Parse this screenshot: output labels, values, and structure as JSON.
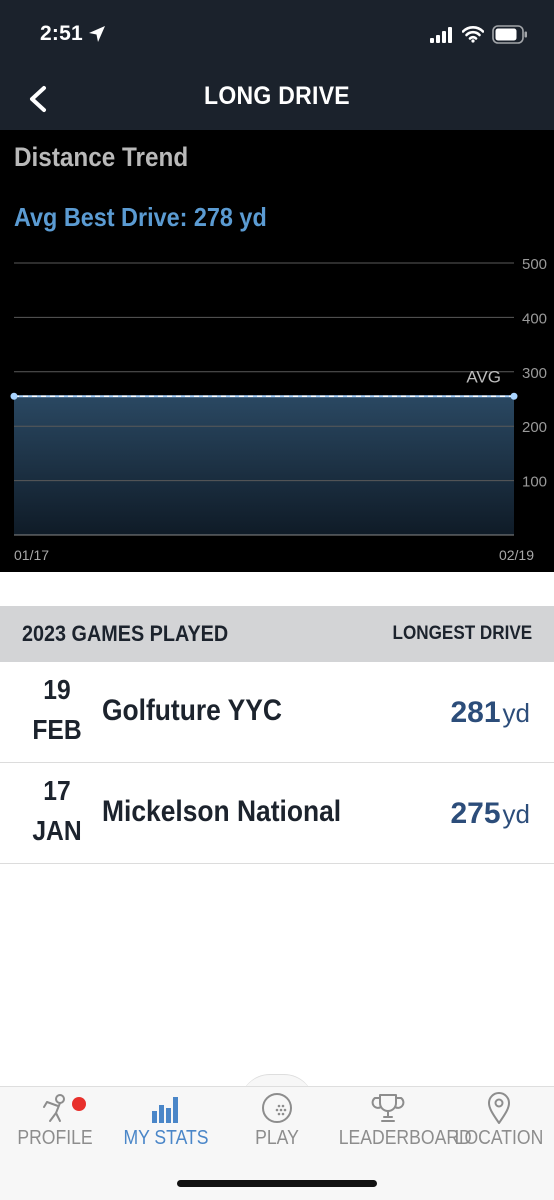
{
  "status_bar": {
    "time": "2:51"
  },
  "nav": {
    "title": "LONG DRIVE"
  },
  "chart_section": {
    "heading": "Distance Trend",
    "avg_label": "Avg Best Drive: 278 yd"
  },
  "chart_data": {
    "type": "area",
    "x_labels": [
      "01/17",
      "02/19"
    ],
    "y_ticks": [
      100,
      200,
      300,
      400,
      500
    ],
    "ylim": [
      0,
      500
    ],
    "series": [
      {
        "values": [
          255,
          255
        ]
      }
    ],
    "avg_line": {
      "label": "AVG",
      "value": 255
    },
    "grid": true,
    "colors": {
      "line": "#a9d4ff",
      "fill_top": "#2a4862",
      "fill_bottom": "#0f1b27",
      "grid": "#5a5a5a"
    }
  },
  "table": {
    "header_left": "2023 GAMES PLAYED",
    "header_right": "LONGEST DRIVE",
    "rows": [
      {
        "day": "19",
        "month": "FEB",
        "course": "Golfuture YYC",
        "distance": "281",
        "unit": "yd"
      },
      {
        "day": "17",
        "month": "JAN",
        "course": "Mickelson National",
        "distance": "275",
        "unit": "yd"
      }
    ]
  },
  "tabs": [
    {
      "label": "PROFILE",
      "icon": "profile-icon",
      "active": false,
      "has_notification": true
    },
    {
      "label": "MY STATS",
      "icon": "stats-bars-icon",
      "active": true
    },
    {
      "label": "PLAY",
      "icon": "golf-ball-icon",
      "active": false
    },
    {
      "label": "LEADERBOARD",
      "icon": "trophy-icon",
      "active": false
    },
    {
      "label": "LOCATION",
      "icon": "location-pin-icon",
      "active": false
    }
  ],
  "colors": {
    "accent": "#4a86c8",
    "dark_bg": "#1b222c",
    "notification": "#e8302c",
    "distance": "#2c4d7a"
  }
}
